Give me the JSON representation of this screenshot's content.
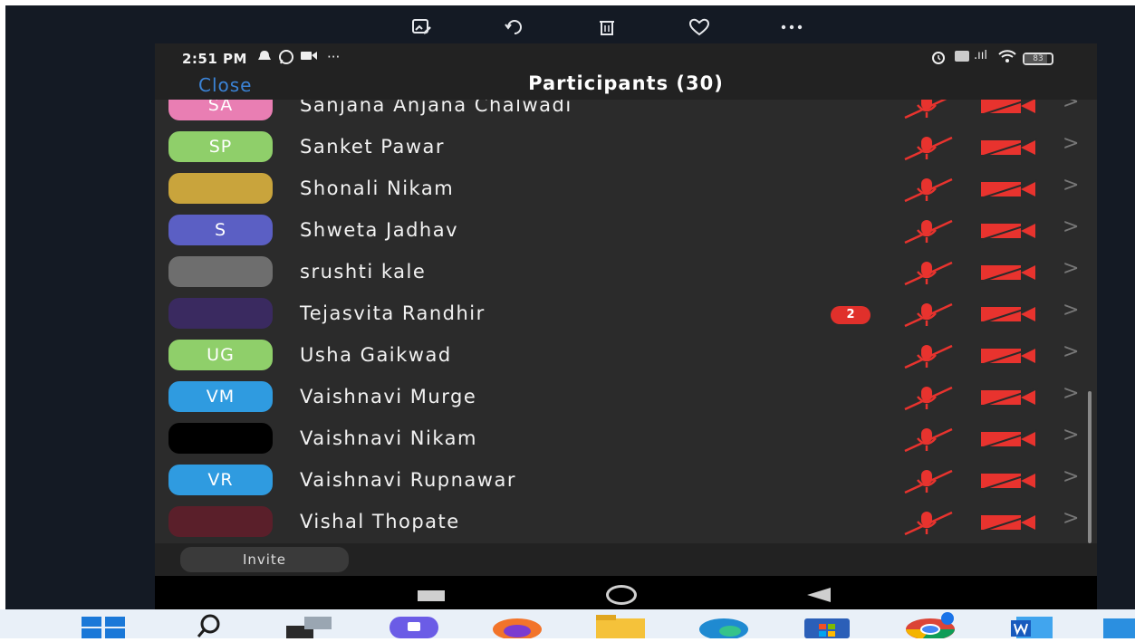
{
  "status_bar": {
    "time": "2:51 PM",
    "more": "···",
    "signal": ".ııl",
    "battery": "83"
  },
  "header": {
    "close_label": "Close",
    "title": "Participants (30)"
  },
  "participants": [
    {
      "name": "Sanjana Anjana Chalwadi",
      "initials": "SA",
      "avatar_color": "#e97eb3"
    },
    {
      "name": "Sanket Pawar",
      "initials": "SP",
      "avatar_color": "#8fcf6a"
    },
    {
      "name": "Shonali Nikam",
      "initials": "",
      "avatar_color": "#c9a43c",
      "avatar_photo": true
    },
    {
      "name": "Shweta Jadhav",
      "initials": "S",
      "avatar_color": "#5b5fc4"
    },
    {
      "name": "srushti kale",
      "initials": "",
      "avatar_color": "#6e6e6e",
      "avatar_photo": true
    },
    {
      "name": "Tejasvita Randhir",
      "initials": "",
      "avatar_color": "#3a2a60",
      "avatar_photo": true,
      "badge": "2"
    },
    {
      "name": "Usha Gaikwad",
      "initials": "UG",
      "avatar_color": "#8fcf6a"
    },
    {
      "name": "Vaishnavi Murge",
      "initials": "VM",
      "avatar_color": "#2f9be0"
    },
    {
      "name": "Vaishnavi Nikam",
      "initials": "",
      "avatar_color": "#000000",
      "avatar_photo": true
    },
    {
      "name": "Vaishnavi Rupnawar",
      "initials": "VR",
      "avatar_color": "#2f9be0"
    },
    {
      "name": "Vishal Thopate",
      "initials": "",
      "avatar_color": "#5a1f2a",
      "avatar_photo": true
    }
  ],
  "invite_label": "Invite",
  "colors": {
    "muted_red": "#e8332e",
    "close_blue": "#3b83d6",
    "badge_red": "#e0302b"
  },
  "icons": {
    "viewer_toolbar": [
      "edit-image-icon",
      "rotate-icon",
      "delete-icon",
      "favorite-icon",
      "more-icon"
    ],
    "taskbar": [
      "windows-start-icon",
      "search-icon",
      "task-view-icon",
      "teams-chat-icon",
      "firefox-icon",
      "file-explorer-icon",
      "edge-icon",
      "microsoft-store-icon",
      "chrome-icon",
      "word-icon",
      "photos-icon"
    ]
  }
}
